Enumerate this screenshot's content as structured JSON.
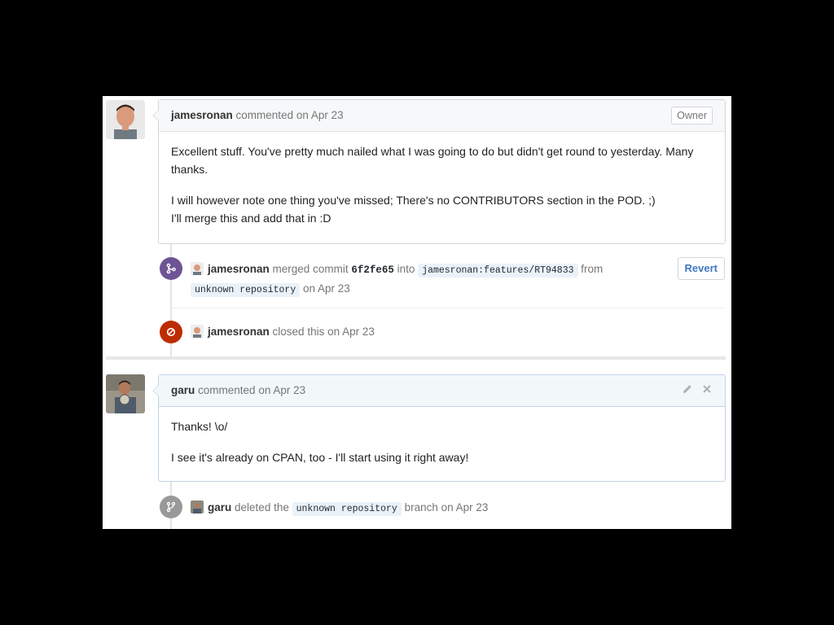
{
  "comments": [
    {
      "author": "jamesronan",
      "meta": "commented on Apr 23",
      "badge": "Owner",
      "paragraphs": [
        "Excellent stuff. You've pretty much nailed what I was going to do but didn't get round to yesterday. Many thanks.",
        "I will however note one thing you've missed; There's no CONTRIBUTORS section in the POD. ;)",
        "I'll merge this and add that in :D"
      ]
    },
    {
      "author": "garu",
      "meta": "commented on Apr 23",
      "paragraphs": [
        "Thanks! \\o/",
        "I see it's already on CPAN, too - I'll start using it right away!"
      ]
    }
  ],
  "events": {
    "merge": {
      "author": "jamesronan",
      "text1": "merged commit",
      "sha": "6f2fe65",
      "text2": "into",
      "branch": "jamesronan:features/RT94833",
      "text3": "from",
      "repo": "unknown repository",
      "date": "on Apr 23",
      "button": "Revert",
      "badge_color": "#6e5494"
    },
    "close": {
      "author": "jamesronan",
      "text": "closed this on Apr 23",
      "badge_color": "#bd2c00"
    },
    "delete": {
      "author": "garu",
      "text1": "deleted the",
      "branch": "unknown repository",
      "text2": "branch on Apr 23",
      "badge_color": "#999999"
    }
  },
  "icons": {
    "merge": "git-merge-icon",
    "close": "circle-slash-icon",
    "delete": "git-branch-icon",
    "edit": "pencil-icon",
    "remove": "x-icon"
  }
}
